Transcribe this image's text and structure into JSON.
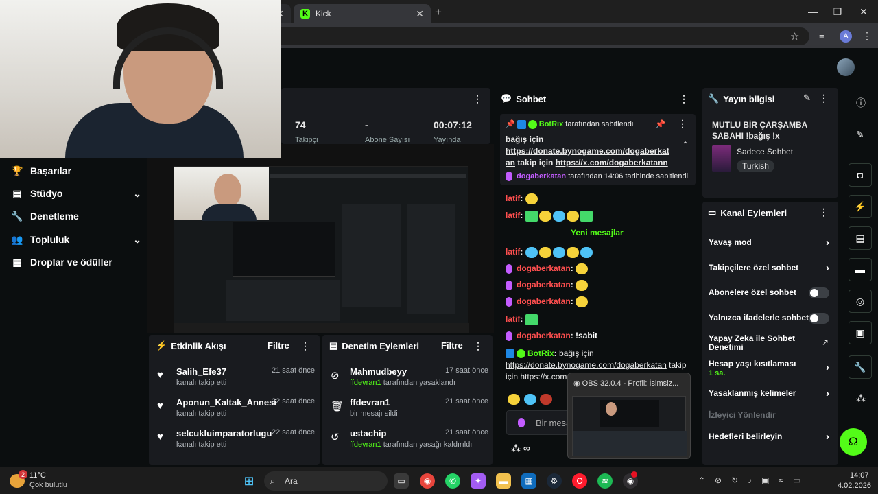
{
  "browser": {
    "tab2_title": "Kick",
    "profile_initial": "A"
  },
  "sidebar": {
    "items": [
      {
        "label": "Başarılar",
        "icon": "trophy-icon"
      },
      {
        "label": "Stüdyo",
        "icon": "studio-icon"
      },
      {
        "label": "Denetleme",
        "icon": "wrench-icon"
      },
      {
        "label": "Topluluk",
        "icon": "people-icon"
      },
      {
        "label": "Droplar ve ödüller",
        "icon": "drops-icon"
      }
    ]
  },
  "stats": {
    "followers_value": "74",
    "subs_value": "-",
    "uptime_value": "00:07:12",
    "label_1": "Takipçi",
    "label_2": "Abone Sayısı",
    "label_3": "Yayında"
  },
  "activity": {
    "title": "Etkinlik Akışı",
    "filter": "Filtre",
    "rows": [
      {
        "name": "Salih_Efe37",
        "sub": "kanalı takip etti",
        "time": "21 saat önce"
      },
      {
        "name": "Aponun_Kaltak_Annesi",
        "sub": "kanalı takip etti",
        "time": "22 saat önce"
      },
      {
        "name": "selcukluimparatorlugu",
        "sub": "kanalı takip etti",
        "time": "22 saat önce"
      }
    ]
  },
  "modlog": {
    "title": "Denetim Eylemleri",
    "filter": "Filtre",
    "rows": [
      {
        "name": "Mahmudbeyy",
        "actor": "ffdevran1",
        "sub": "tarafından yasaklandı",
        "time": "17 saat önce"
      },
      {
        "name": "ffdevran1",
        "actor": "",
        "sub": "bir mesajı sildi",
        "time": "21 saat önce"
      },
      {
        "name": "ustachip",
        "actor": "ffdevran1",
        "sub": "tarafından yasağı kaldırıldı",
        "time": "21 saat önce"
      }
    ]
  },
  "chat": {
    "title": "Sohbet",
    "pinned_by_user": "BotRix",
    "pinned_by_text": "tarafından sabitlendi",
    "pinned_msg_1": "bağış için",
    "pinned_link_1": "https://donate.bynogame.com/dogaberkat",
    "pinned_link_1b": "an",
    "pinned_msg_2": "takip için",
    "pinned_link_2": "https://x.com/dogaberkatann",
    "pinned_footer_user": "dogaberkatan",
    "pinned_footer_text": "tarafından 14:06 tarihinde sabitlendi",
    "new_messages": "Yeni mesajlar",
    "user_latif": "latif",
    "user_doga": "dogaberkatan",
    "sabit": "!sabit",
    "bot_user": "BotRix",
    "bot_msg": "bağış için",
    "bot_link": "https://donate.bynogame.com/dogaberkatan",
    "bot_tail": "takip",
    "bot_line2": "için https://x.com",
    "input_placeholder": "Bir mesaj"
  },
  "obs_popup": {
    "title": "OBS 32.0.4 - Profil: İsimsiz..."
  },
  "stream_info": {
    "title_label": "Yayın bilgisi",
    "stream_title": "MUTLU BİR ÇARŞAMBA SABAHI !bağış !x",
    "category": "Sadece Sohbet",
    "tag": "Turkish"
  },
  "channel_actions": {
    "title": "Kanal Eylemleri",
    "slow_mode": "Yavaş mod",
    "followers_only": "Takipçilere özel sohbet",
    "subs_only": "Abonelere özel sohbet",
    "emotes_only": "Yalnızca ifadelerle sohbet",
    "ai_mod": "Yapay Zeka ile Sohbet Denetimi",
    "age_limit": "Hesap yaşı kısıtlaması",
    "age_value": "1 sa.",
    "banned_words": "Yasaklanmış kelimeler",
    "viewer_redirect": "İzleyici Yönlendir",
    "goals": "Hedefleri belirleyin"
  },
  "taskbar": {
    "weather_temp": "11°C",
    "weather_text": "Çok bulutlu",
    "weather_badge": "2",
    "search": "Ara",
    "time": "14:07",
    "date": "4.02.2026"
  },
  "colors": {
    "accent": "#53fc18",
    "panel": "#191b1f",
    "background": "#0b0e0f"
  }
}
